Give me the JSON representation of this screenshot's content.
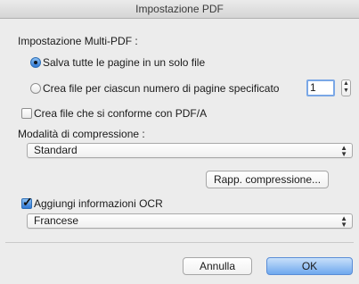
{
  "window": {
    "title": "Impostazione PDF"
  },
  "multi_pdf": {
    "section_label": "Impostazione Multi-PDF :",
    "option_single_label": "Salva tutte le pagine in un solo file",
    "option_split_label": "Crea file per ciascun numero di pagine specificato",
    "page_count_value": "1"
  },
  "pdfa": {
    "label": "Crea file che si conforme con PDF/A",
    "checked": false
  },
  "compression": {
    "section_label": "Modalità di compressione :",
    "selected": "Standard",
    "ratio_button_label": "Rapp. compressione..."
  },
  "ocr": {
    "label": "Aggiungi informazioni OCR",
    "checked": true,
    "language_selected": "Francese"
  },
  "footer": {
    "cancel_label": "Annulla",
    "ok_label": "OK"
  }
}
